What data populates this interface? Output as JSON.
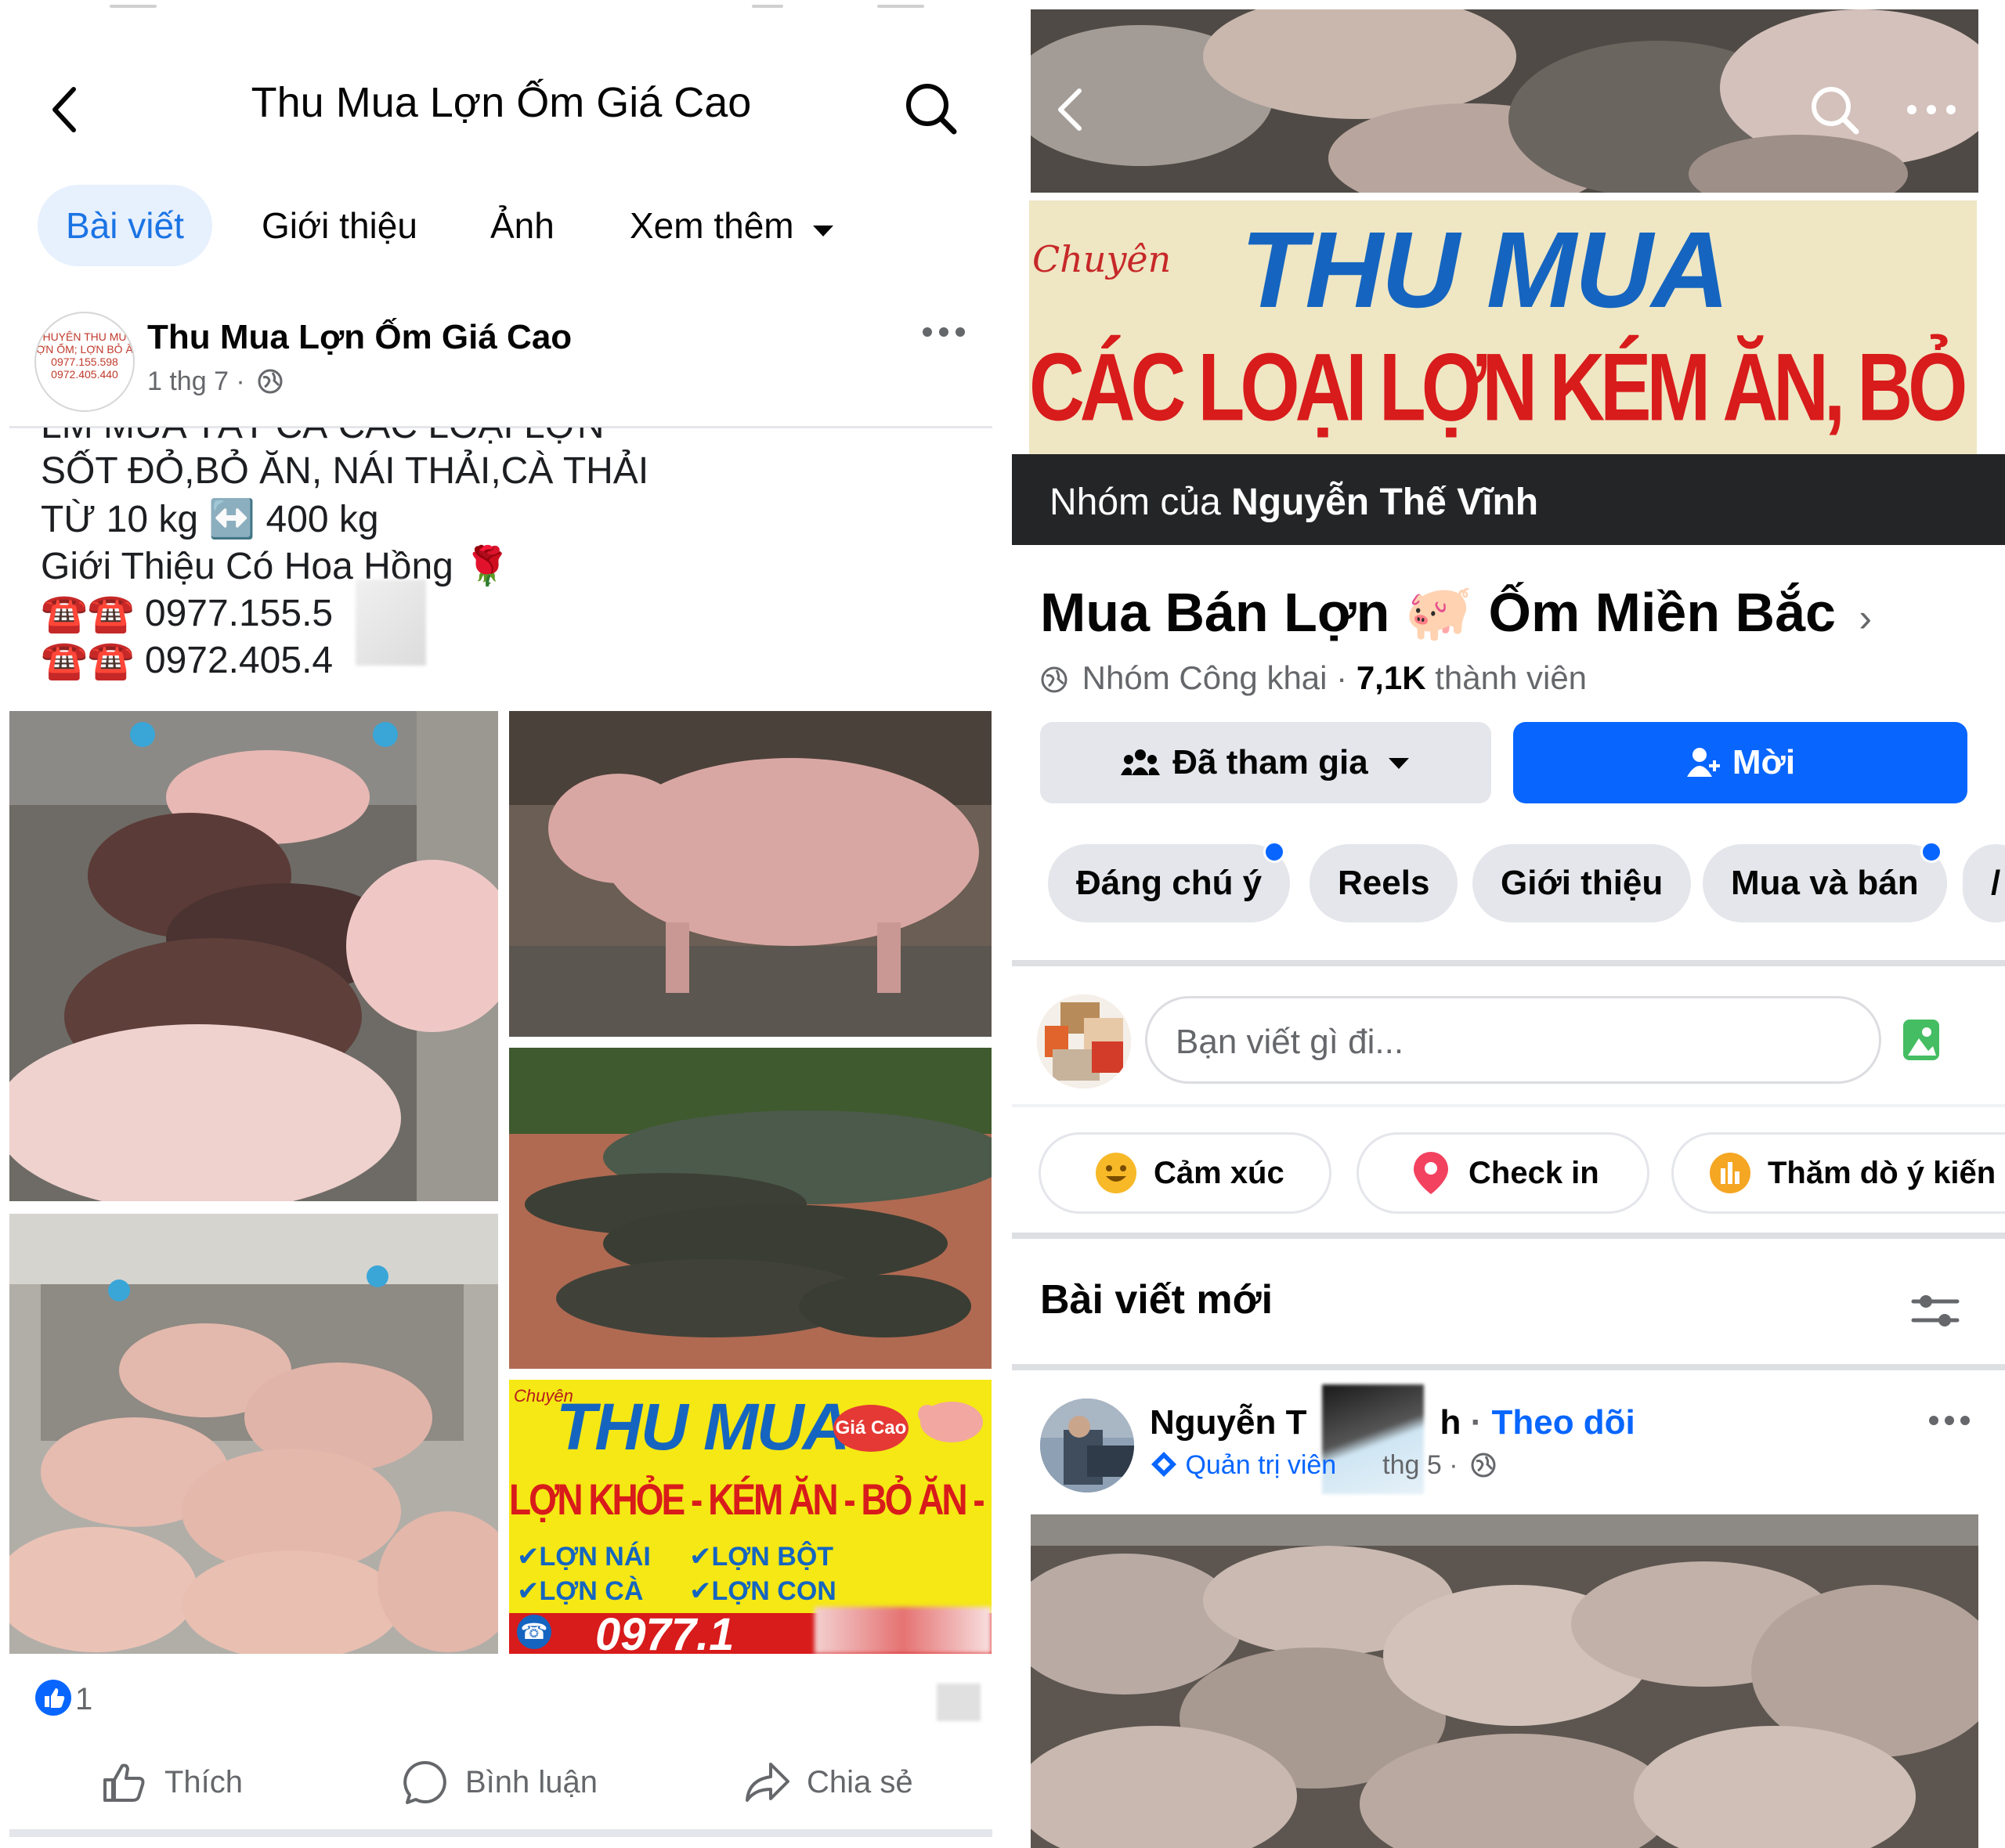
{
  "left_panel": {
    "header": {
      "title": "Thu Mua Lợn Ốm Giá Cao"
    },
    "tabs": [
      {
        "label": "Bài viết",
        "active": true
      },
      {
        "label": "Giới thiệu"
      },
      {
        "label": "Ảnh"
      },
      {
        "label": "Xem thêm"
      }
    ],
    "post": {
      "author": "Thu Mua Lợn Ốm Giá Cao",
      "avatar_text": [
        "HUYÊN THU MU",
        "ỢN ỐM; LỢN BỎ Ă",
        "0977.155.598",
        "0972.405.440"
      ],
      "meta": "1 thg 7 ·",
      "text_lines": [
        "LM MUA TẤT CẢ CÁC LOẠI LỢN",
        "SỐT ĐỎ,BỎ ĂN, NÁI THẢI,CÀ THẢI",
        "TỪ 10 kg ↔️ 400 kg",
        "Giới Thiệu Có Hoa Hồng 🌹",
        "☎️☎️ 0977.155.5",
        "☎️☎️ 0972.405.4"
      ],
      "ad_image": {
        "label_small": "Chuyên",
        "title": "THU MUA",
        "badge": "Giá Cao",
        "line2": "LỢN KHỎE - KÉM ĂN - BỎ ĂN - LỢN THANH LÝ",
        "check1": "✔LỢN NÁI",
        "check2": "✔LỢN BỘT",
        "check3": "✔LỢN CÀ",
        "check4": "✔LỢN CON",
        "phone": "0977.1"
      },
      "reaction_count": "1",
      "actions": {
        "like": "Thích",
        "comment": "Bình luận",
        "share": "Chia sẻ"
      }
    }
  },
  "right_panel": {
    "banner": {
      "small": "Chuyên",
      "title": "THU MUA",
      "subtitle": "CÁC LOẠI LỢN KÉM ĂN, BỎ ĂN"
    },
    "owner_bar": {
      "prefix": "Nhóm của",
      "owner": "Nguyễn Thế Vĩnh"
    },
    "group": {
      "title_part1": "Mua Bán Lợn",
      "title_emoji": "🐖",
      "title_part2": "Ốm Miền Bắc",
      "chevron": "›",
      "privacy": "Nhóm Công khai",
      "members_count": "7,1K",
      "members_label": "thành viên"
    },
    "buttons": {
      "joined": "Đã tham gia",
      "invite": "Mời"
    },
    "chips": [
      {
        "label": "Đáng chú ý",
        "dot": true
      },
      {
        "label": "Reels"
      },
      {
        "label": "Giới thiệu"
      },
      {
        "label": "Mua và bán",
        "dot": true
      },
      {
        "label": "/"
      }
    ],
    "composer": {
      "placeholder": "Bạn viết gì đi..."
    },
    "quick_actions": [
      {
        "label": "Cảm xúc",
        "icon": "smiley-icon"
      },
      {
        "label": "Check in",
        "icon": "location-pin-icon"
      },
      {
        "label": "Thăm dò ý kiến",
        "icon": "poll-icon"
      }
    ],
    "section": {
      "title": "Bài viết mới"
    },
    "post": {
      "author_visible_start": "Nguyễn T",
      "author_visible_end": "h",
      "follow": "Theo dõi",
      "role": "Quản trị viên",
      "meta": "thg 5 ·"
    }
  },
  "colors": {
    "facebook_blue": "#0866ff",
    "active_tab_bg": "#e7f0fd",
    "secondary_text": "#65676b",
    "button_grey": "#e4e6eb",
    "owner_bar": "#242526",
    "banner_blue": "#1565c0",
    "banner_red": "#d81b1b"
  }
}
